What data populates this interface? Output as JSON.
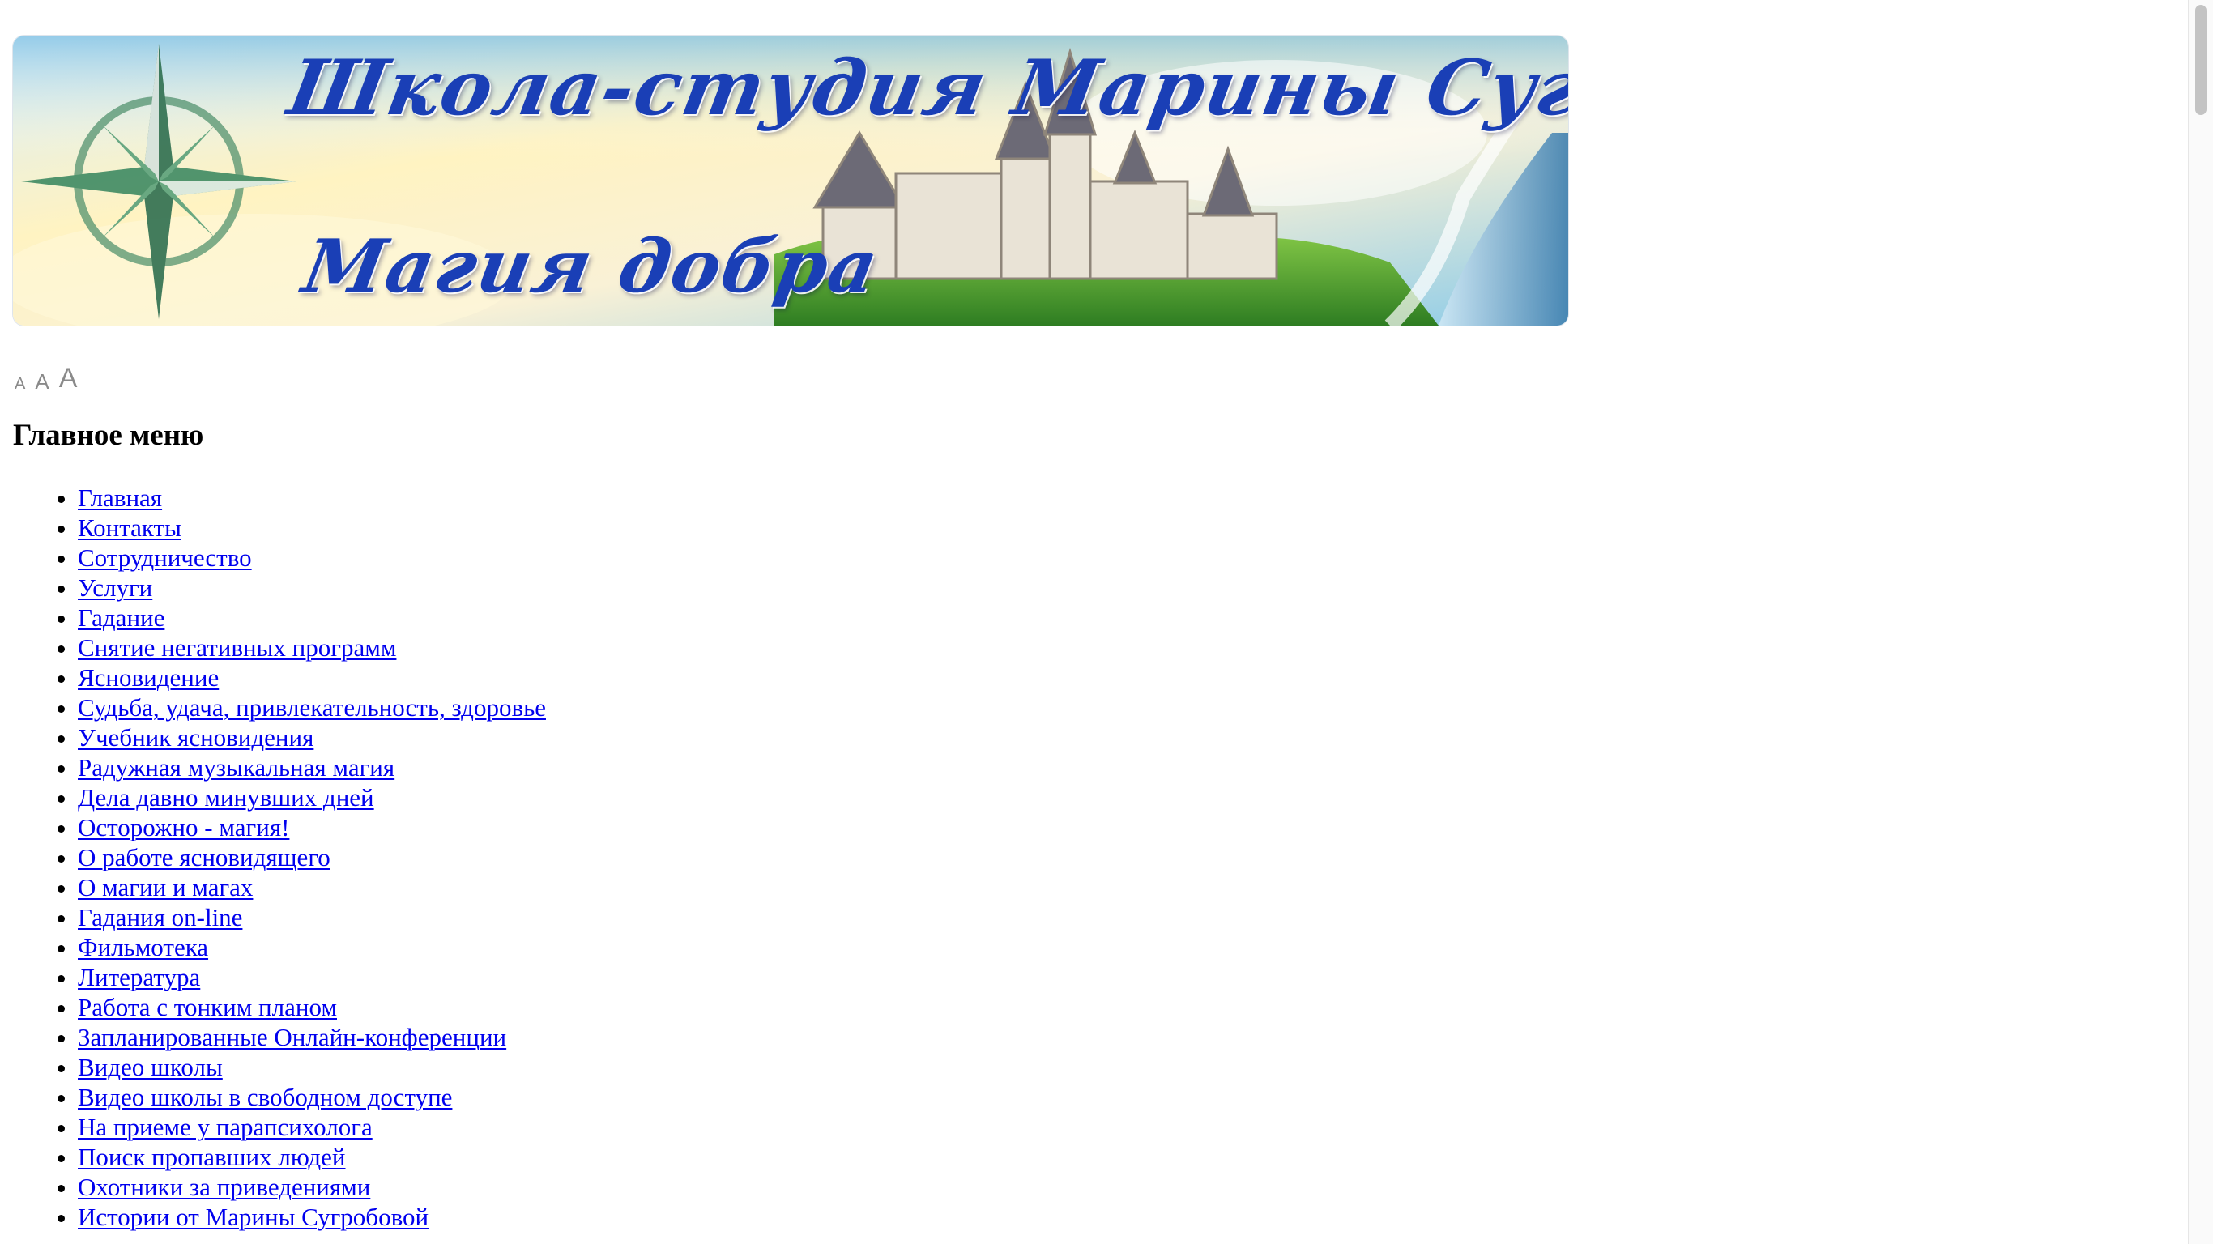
{
  "banner": {
    "title": "Школа-студия Марины Сугробовой",
    "subtitle": "Магия добра"
  },
  "font_resizer": {
    "small": "A",
    "medium": "A",
    "large": "A"
  },
  "menu": {
    "heading": "Главное меню",
    "items": [
      "Главная",
      "Контакты",
      "Сотрудничество",
      "Услуги",
      "Гадание",
      "Снятие негативных программ",
      "Ясновидение",
      "Судьба, удача, привлекательность, здоровье",
      "Учебник ясновидения",
      "Радужная музыкальная магия",
      "Дела давно минувших дней",
      "Осторожно - магия!",
      "О работе ясновидящего",
      "О магии и магах",
      "Гадания on-line",
      "Фильмотека",
      "Литература",
      "Работа с тонким планом",
      "Запланированные Онлайн-конференции",
      "Видео школы",
      "Видео школы в свободном доступе",
      "На приеме у парапсихолога",
      "Поиск пропавших людей",
      "Охотники за приведениями",
      "Истории от Марины Сугробовой"
    ]
  },
  "colors": {
    "link": "#0000ee",
    "banner_text": "#1a3fb6",
    "resizer": "#8a8a8a"
  }
}
